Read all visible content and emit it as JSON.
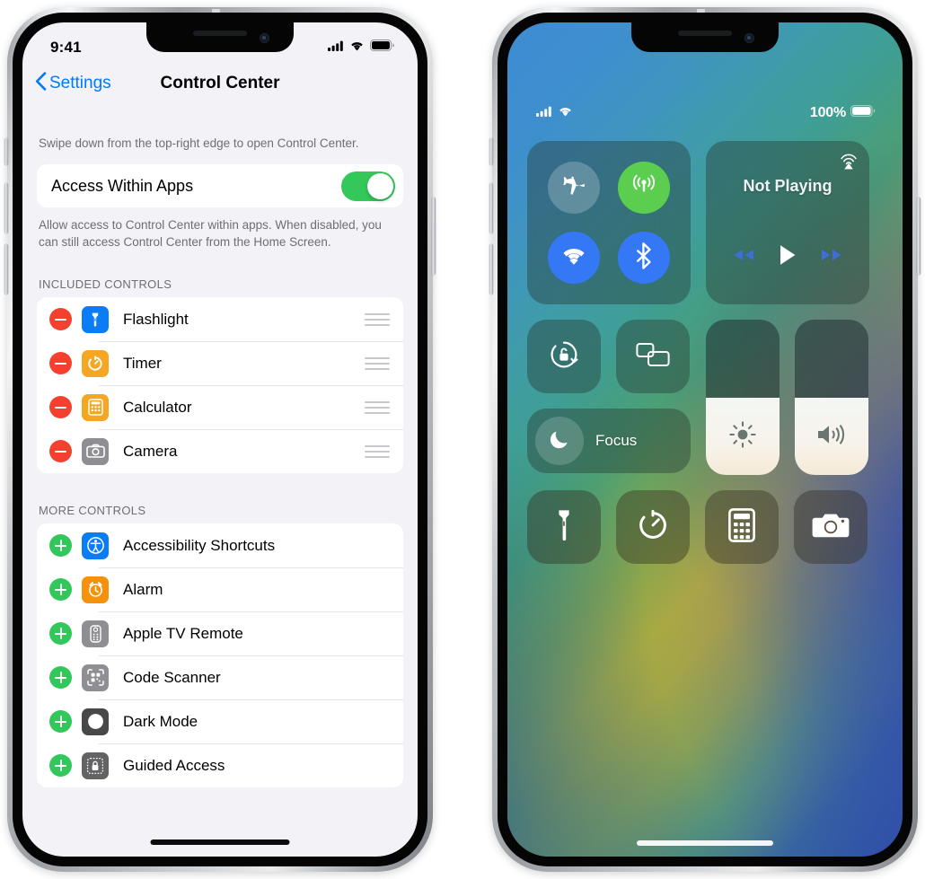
{
  "left_phone": {
    "status_bar": {
      "time": "9:41",
      "cellular_icon": "cellular-bars-icon",
      "wifi_icon": "wifi-icon",
      "battery_icon": "battery-full-icon"
    },
    "nav": {
      "back_label": "Settings",
      "back_icon": "chevron-left-icon",
      "title": "Control Center"
    },
    "intro_note": "Swipe down from the top-right edge to open Control Center.",
    "access_row": {
      "label": "Access Within Apps",
      "toggle_state": "on",
      "toggle_color": "#34c759"
    },
    "access_note": "Allow access to Control Center within apps. When disabled, you can still access Control Center from the Home Screen.",
    "included_header": "INCLUDED CONTROLS",
    "included": [
      {
        "label": "Flashlight",
        "icon": "flashlight-icon",
        "tile_color": "#0a7cf6",
        "action": "remove",
        "action_icon": "minus-circle-icon",
        "handle_icon": "drag-handle-icon"
      },
      {
        "label": "Timer",
        "icon": "timer-icon",
        "tile_color": "#f5a623",
        "action": "remove",
        "action_icon": "minus-circle-icon",
        "handle_icon": "drag-handle-icon"
      },
      {
        "label": "Calculator",
        "icon": "calculator-icon",
        "tile_color": "#f5a623",
        "action": "remove",
        "action_icon": "minus-circle-icon",
        "handle_icon": "drag-handle-icon"
      },
      {
        "label": "Camera",
        "icon": "camera-icon",
        "tile_color": "#8e8e93",
        "action": "remove",
        "action_icon": "minus-circle-icon",
        "handle_icon": "drag-handle-icon"
      }
    ],
    "more_header": "MORE CONTROLS",
    "more": [
      {
        "label": "Accessibility Shortcuts",
        "icon": "accessibility-icon",
        "tile_color": "#0a7cf6",
        "action": "add",
        "action_icon": "plus-circle-icon"
      },
      {
        "label": "Alarm",
        "icon": "alarm-clock-icon",
        "tile_color": "#f5910b",
        "action": "add",
        "action_icon": "plus-circle-icon"
      },
      {
        "label": "Apple TV Remote",
        "icon": "tv-remote-icon",
        "tile_color": "#8e8e93",
        "action": "add",
        "action_icon": "plus-circle-icon"
      },
      {
        "label": "Code Scanner",
        "icon": "qr-scanner-icon",
        "tile_color": "#8e8e93",
        "action": "add",
        "action_icon": "plus-circle-icon"
      },
      {
        "label": "Dark Mode",
        "icon": "dark-mode-icon",
        "tile_color": "#48484a",
        "action": "add",
        "action_icon": "plus-circle-icon"
      },
      {
        "label": "Guided Access",
        "icon": "guided-access-icon",
        "tile_color": "#636366",
        "action": "add",
        "action_icon": "plus-circle-icon"
      }
    ],
    "remove_color": "#f4402f",
    "add_color": "#32c75a",
    "accent_color": "#007aff"
  },
  "right_phone": {
    "status_bar": {
      "cellular_icon": "cellular-bars-icon",
      "wifi_icon": "wifi-icon",
      "battery_percent": "100%",
      "battery_icon": "battery-full-icon"
    },
    "connectivity": [
      {
        "name": "airplane-mode",
        "icon": "airplane-icon",
        "state": "off",
        "color": "rgba(255,255,255,.22)"
      },
      {
        "name": "cellular-data",
        "icon": "antenna-icon",
        "state": "on",
        "color": "#5bce4f"
      },
      {
        "name": "wifi",
        "icon": "wifi-icon",
        "state": "on",
        "color": "#3478f6"
      },
      {
        "name": "bluetooth",
        "icon": "bluetooth-icon",
        "state": "on",
        "color": "#3478f6"
      }
    ],
    "media": {
      "title": "Not Playing",
      "airplay_icon": "airplay-audio-icon",
      "rewind_icon": "rewind-icon",
      "play_icon": "play-icon",
      "forward_icon": "fast-forward-icon"
    },
    "toggles": [
      {
        "name": "rotation-lock",
        "icon": "rotation-lock-icon"
      },
      {
        "name": "screen-mirroring",
        "icon": "screen-mirroring-icon"
      }
    ],
    "focus": {
      "label": "Focus",
      "icon": "moon-icon"
    },
    "sliders": [
      {
        "name": "brightness",
        "icon": "brightness-icon",
        "value": 50
      },
      {
        "name": "volume",
        "icon": "volume-icon",
        "value": 50
      }
    ],
    "quick_controls": [
      {
        "name": "flashlight",
        "icon": "flashlight-icon"
      },
      {
        "name": "timer",
        "icon": "timer-icon"
      },
      {
        "name": "calculator",
        "icon": "calculator-icon"
      },
      {
        "name": "camera",
        "icon": "camera-icon"
      }
    ]
  }
}
